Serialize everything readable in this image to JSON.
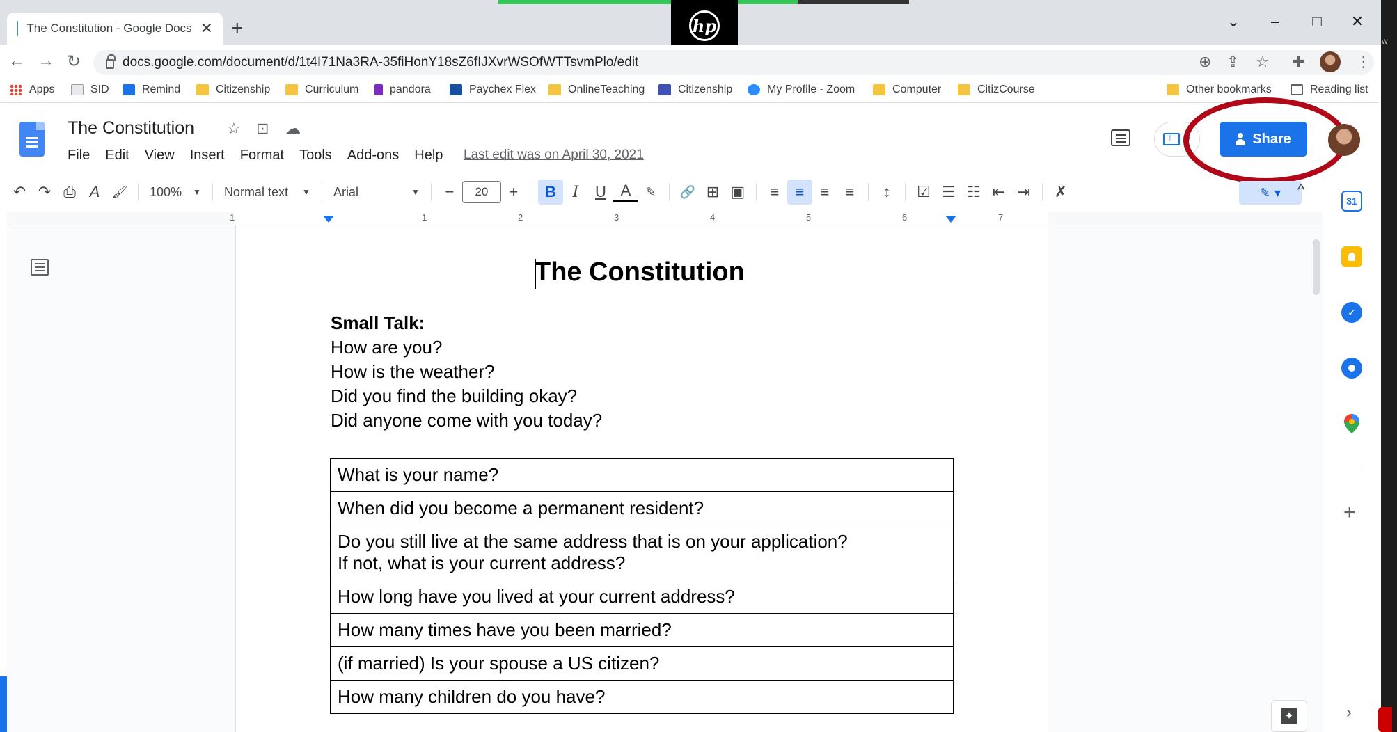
{
  "browser": {
    "tab_title": "The Constitution - Google Docs",
    "tab_close": "✕",
    "new_tab": "+",
    "hp_logo_text": "hp",
    "url": "docs.google.com/document/d/1t4I71Na3RA-35fiHonY18sZ6fIJXvrWSOfWTTsvmPlo/edit",
    "window_controls": {
      "dropdown": "⌄",
      "minimize": "–",
      "maximize": "□",
      "close": "✕"
    },
    "nav": {
      "back": "←",
      "forward": "→",
      "reload": "↻"
    },
    "omni_icons": {
      "zoom": "⊕",
      "share": "⇪",
      "star": "☆",
      "extensions": "✚",
      "menu": "⋮"
    }
  },
  "bookmarks": [
    {
      "label": "Apps",
      "icon": "apps-grid-icon"
    },
    {
      "label": "SID",
      "icon": "page-icon"
    },
    {
      "label": "Remind",
      "icon": "remind-icon"
    },
    {
      "label": "Citizenship",
      "icon": "folder-icon"
    },
    {
      "label": "Curriculum",
      "icon": "folder-icon"
    },
    {
      "label": "pandora",
      "icon": "pandora-icon"
    },
    {
      "label": "Paychex Flex",
      "icon": "paychex-icon"
    },
    {
      "label": "OnlineTeaching",
      "icon": "folder-icon"
    },
    {
      "label": "Citizenship",
      "icon": "forms-icon"
    },
    {
      "label": "My Profile - Zoom",
      "icon": "zoom-icon"
    },
    {
      "label": "Computer",
      "icon": "folder-icon"
    },
    {
      "label": "CitizCourse",
      "icon": "folder-icon"
    }
  ],
  "bookmarks_right": [
    {
      "label": "Other bookmarks",
      "icon": "folder-icon"
    },
    {
      "label": "Reading list",
      "icon": "reading-list-icon"
    }
  ],
  "docs": {
    "title": "The Constitution",
    "menu": [
      "File",
      "Edit",
      "View",
      "Insert",
      "Format",
      "Tools",
      "Add-ons",
      "Help"
    ],
    "last_edit": "Last edit was on April 30, 2021",
    "share_label": "Share",
    "title_icons": {
      "star": "☆",
      "move": "⊡",
      "cloud": "☁"
    }
  },
  "toolbar": {
    "zoom": "100%",
    "style": "Normal text",
    "font": "Arial",
    "font_size": "20",
    "minus": "−",
    "plus": "+",
    "bold": "B",
    "italic": "I",
    "underline": "U",
    "text_color": "A",
    "undo": "↶",
    "redo": "↷",
    "print": "⎙",
    "spellcheck": "A",
    "paint_format": "🖌",
    "link": "🔗",
    "comment": "⊞",
    "image": "▣",
    "align_left": "≡",
    "align_center": "≡",
    "align_right": "≡",
    "justify": "≡",
    "line_spacing": "↕",
    "checklist": "☑",
    "bullets": "☰",
    "numbered": "☷",
    "indent_less": "⇤",
    "indent_more": "⇥",
    "clear_format": "✗",
    "edit_pencil": "✎",
    "collapse": "^"
  },
  "ruler": {
    "numbers": [
      "1",
      "1",
      "2",
      "3",
      "4",
      "5",
      "6",
      "7"
    ]
  },
  "document": {
    "heading": "The Constitution",
    "small_talk_heading": "Small Talk:",
    "small_talk": [
      "How are you?",
      "How is the weather?",
      "Did you find the building okay?",
      "Did anyone come with you today?"
    ],
    "questions": [
      [
        "What is your name?"
      ],
      [
        "When did you become a permanent resident?"
      ],
      [
        "Do you still live at the same address that is on your application?",
        "If not, what is your current address?"
      ],
      [
        "How long have you lived at your current address?"
      ],
      [
        "How many times have you been married?"
      ],
      [
        "(if married)  Is your spouse a US citizen?"
      ],
      [
        "How many children do you have?"
      ]
    ]
  },
  "sidepanel": {
    "calendar_label": "31",
    "plus": "+",
    "expand": "›"
  },
  "colors": {
    "share_blue": "#1a73e8",
    "annotation_red": "#b00818",
    "keep_yellow": "#fbbc04",
    "tasks_blue": "#1a73e8",
    "contacts_blue": "#1a73e8"
  },
  "edge_text": "w"
}
